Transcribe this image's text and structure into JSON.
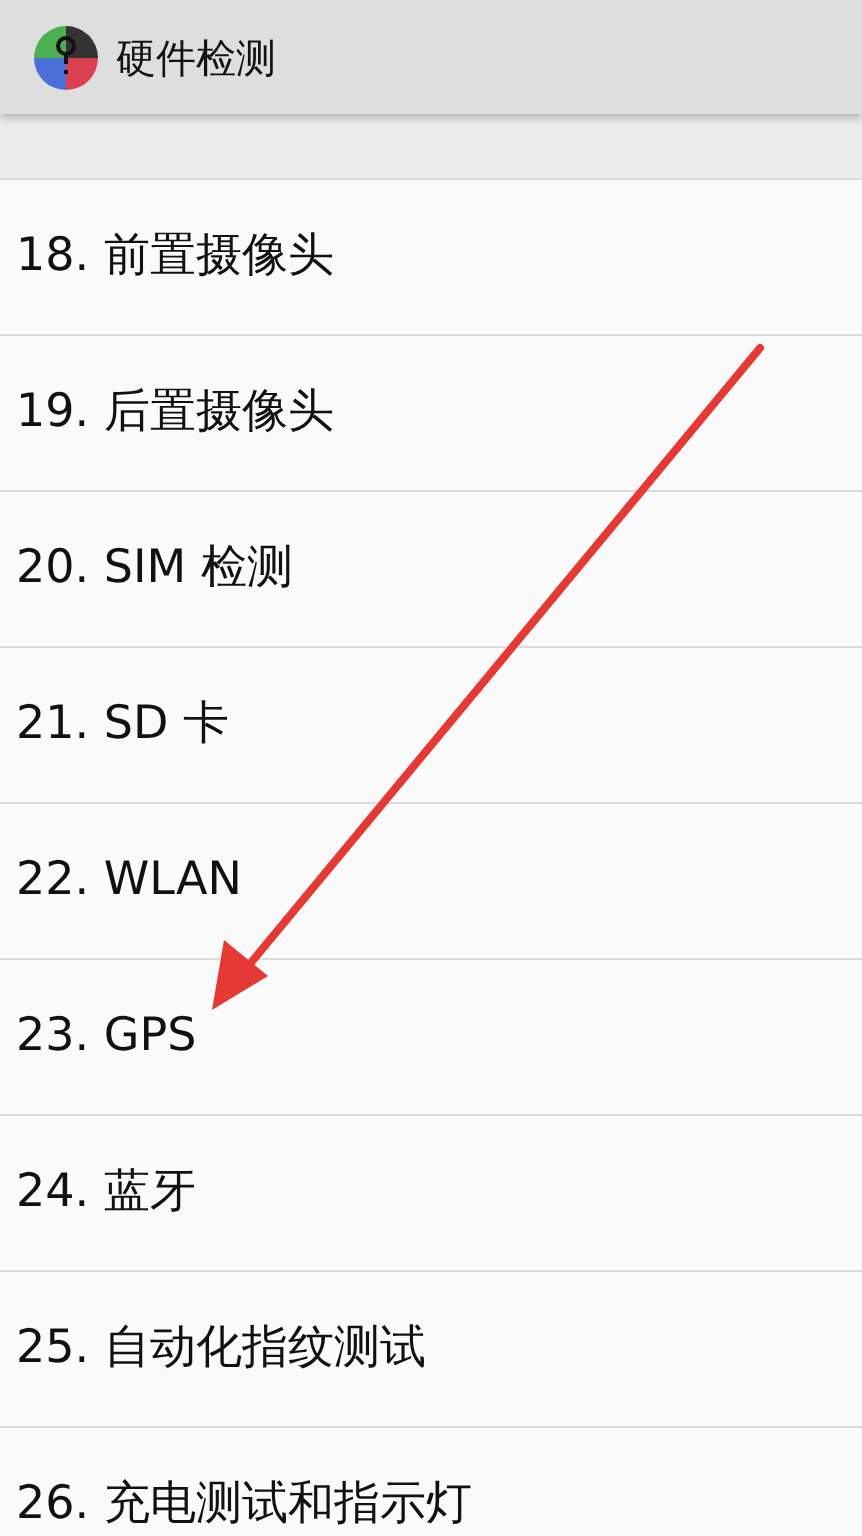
{
  "app_bar": {
    "title": "硬件检测"
  },
  "items": [
    {
      "label": "18. 前置摄像头"
    },
    {
      "label": "19. 后置摄像头"
    },
    {
      "label": "20. SIM 检测"
    },
    {
      "label": "21. SD 卡"
    },
    {
      "label": "22. WLAN"
    },
    {
      "label": "23. GPS"
    },
    {
      "label": "24. 蓝牙"
    },
    {
      "label": "25. 自动化指纹测试"
    },
    {
      "label": "26. 充电测试和指示灯"
    }
  ]
}
